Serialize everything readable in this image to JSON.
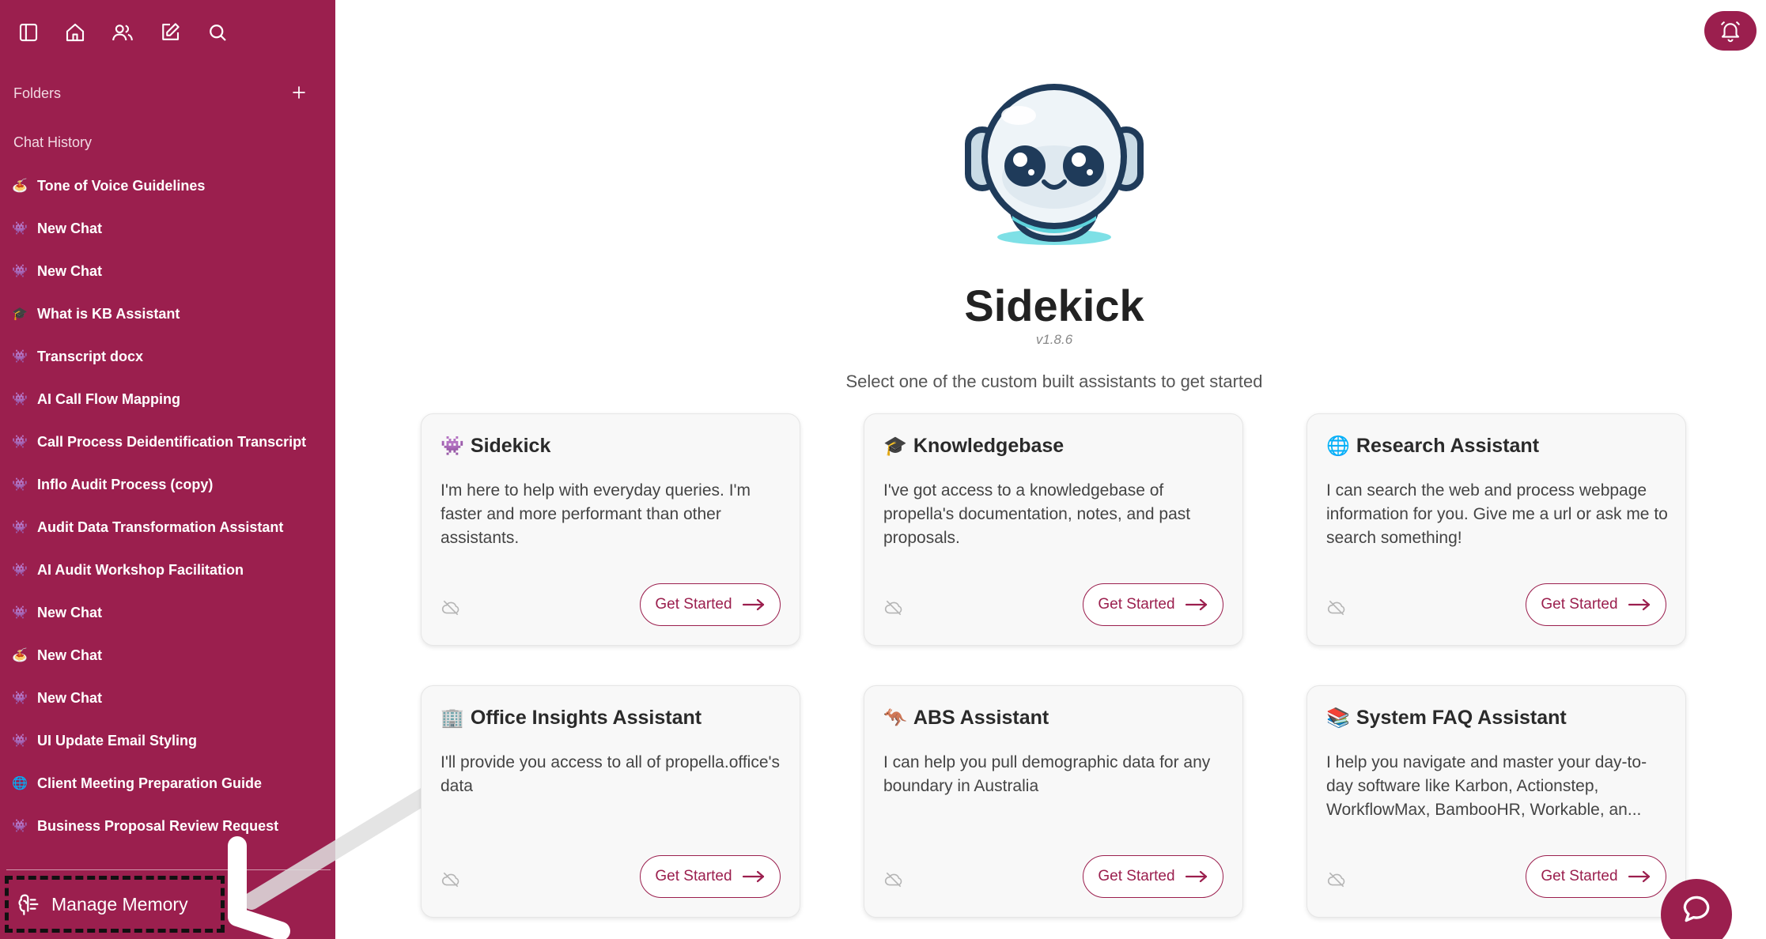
{
  "sidebar": {
    "folders_label": "Folders",
    "history_label": "Chat History",
    "chats": [
      {
        "emoji": "🍝",
        "title": "Tone of Voice Guidelines"
      },
      {
        "emoji": "👾",
        "title": "New Chat"
      },
      {
        "emoji": "👾",
        "title": "New Chat"
      },
      {
        "emoji": "🎓",
        "title": "What is KB Assistant"
      },
      {
        "emoji": "👾",
        "title": "Transcript docx"
      },
      {
        "emoji": "👾",
        "title": "AI Call Flow Mapping"
      },
      {
        "emoji": "👾",
        "title": "Call Process Deidentification Transcript"
      },
      {
        "emoji": "👾",
        "title": "Inflo Audit Process (copy)"
      },
      {
        "emoji": "👾",
        "title": "Audit Data Transformation Assistant"
      },
      {
        "emoji": "👾",
        "title": "AI Audit Workshop Facilitation"
      },
      {
        "emoji": "👾",
        "title": "New Chat"
      },
      {
        "emoji": "🍝",
        "title": "New Chat"
      },
      {
        "emoji": "👾",
        "title": "New Chat"
      },
      {
        "emoji": "👾",
        "title": "UI Update Email Styling"
      },
      {
        "emoji": "🌐",
        "title": "Client Meeting Preparation Guide"
      },
      {
        "emoji": "👾",
        "title": "Business Proposal Review Request"
      }
    ],
    "manage_memory": "Manage Memory"
  },
  "main": {
    "title": "Sidekick",
    "version": "v1.8.6",
    "subtitle": "Select one of the custom built assistants to get started",
    "cards": [
      {
        "emoji": "👾",
        "title": "Sidekick",
        "description": "I'm here to help with everyday queries. I'm faster and more performant than other assistants.",
        "button": "Get Started"
      },
      {
        "emoji": "🎓",
        "title": "Knowledgebase",
        "description": "I've got access to a knowledgebase of propella's documentation, notes, and past proposals.",
        "button": "Get Started"
      },
      {
        "emoji": "🌐",
        "title": "Research Assistant",
        "description": "I can search the web and process webpage information for you. Give me a url or ask me to search something!",
        "button": "Get Started"
      },
      {
        "emoji": "🏢",
        "title": "Office Insights Assistant",
        "description": "I'll provide you access to all of propella.office's data",
        "button": "Get Started"
      },
      {
        "emoji": "🦘",
        "title": "ABS Assistant",
        "description": "I can help you pull demographic data for any boundary in Australia",
        "button": "Get Started"
      },
      {
        "emoji": "📚",
        "title": "System FAQ Assistant",
        "description": "I help you navigate and master your day-to-day software like Karbon, Actionstep, WorkflowMax, BambooHR, Workable, an...",
        "button": "Get Started"
      }
    ]
  },
  "colors": {
    "brand": "#9b1f4e",
    "background": "#ffffff",
    "card": "#f8f8f8"
  }
}
